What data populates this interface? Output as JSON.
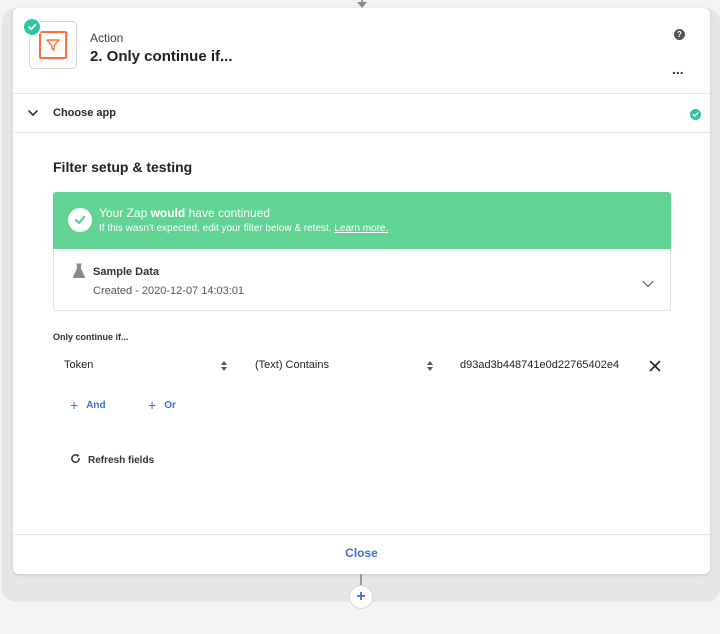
{
  "step": {
    "type_label": "Action",
    "title": "2. Only continue if...",
    "help_glyph": "?",
    "more_glyph": "..."
  },
  "choose_app": {
    "label": "Choose app",
    "status": "complete"
  },
  "filter_setup": {
    "title": "Filter setup & testing",
    "result": {
      "title_prefix": "Your Zap ",
      "title_bold": "would",
      "title_suffix": " have continued",
      "subtitle": "If this wasn't expected, edit your filter below & retest.",
      "link": "Learn more."
    },
    "sample": {
      "title": "Sample Data",
      "created": "Created - 2020-12-07 14:03:01"
    },
    "rules_label": "Only continue if...",
    "rule": {
      "field": "Token",
      "condition": "(Text) Contains",
      "value": "d93ad3b448741e0d22765402e4"
    },
    "and_label": "And",
    "or_label": "Or",
    "refresh_label": "Refresh fields"
  },
  "footer": {
    "close_label": "Close",
    "add_step_glyph": "+"
  },
  "colors": {
    "success": "#61d393",
    "accent_blue": "#3a72d8",
    "filter_orange": "#ff6d3a",
    "check_teal": "#2ec4a4"
  },
  "icons": {
    "app": "filter-icon",
    "badge": "check-circle-icon",
    "flask": "flask-icon",
    "remove": "close-icon",
    "refresh": "refresh-icon"
  }
}
